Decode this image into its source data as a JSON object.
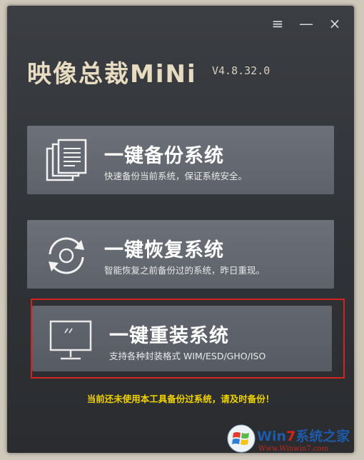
{
  "window": {
    "logo_text": "映像总裁MiNi",
    "version": "V4.8.32.0",
    "menu_icon": "≡",
    "minimize_icon": "—",
    "close_icon": "×"
  },
  "cards": [
    {
      "title": "一键备份系统",
      "desc": "快速备份当前系统，保证系统安全。",
      "icon": "documents-icon"
    },
    {
      "title": "一键恢复系统",
      "desc": "智能恢复之前备份过的系统，昨日重现。",
      "icon": "refresh-icon"
    },
    {
      "title": "一键重装系统",
      "desc": "支持各种封装格式 WIM/ESD/GHO/ISO",
      "icon": "monitor-icon"
    }
  ],
  "warning": "当前还未使用本工具备份过系统，请及时备份！",
  "watermark": {
    "title_prefix": "Win",
    "title_seven": "7",
    "title_suffix": "系统之家",
    "url": "Www.Winwin7.com"
  },
  "colors": {
    "highlight": "#d2231f",
    "warning": "#f0d200"
  }
}
